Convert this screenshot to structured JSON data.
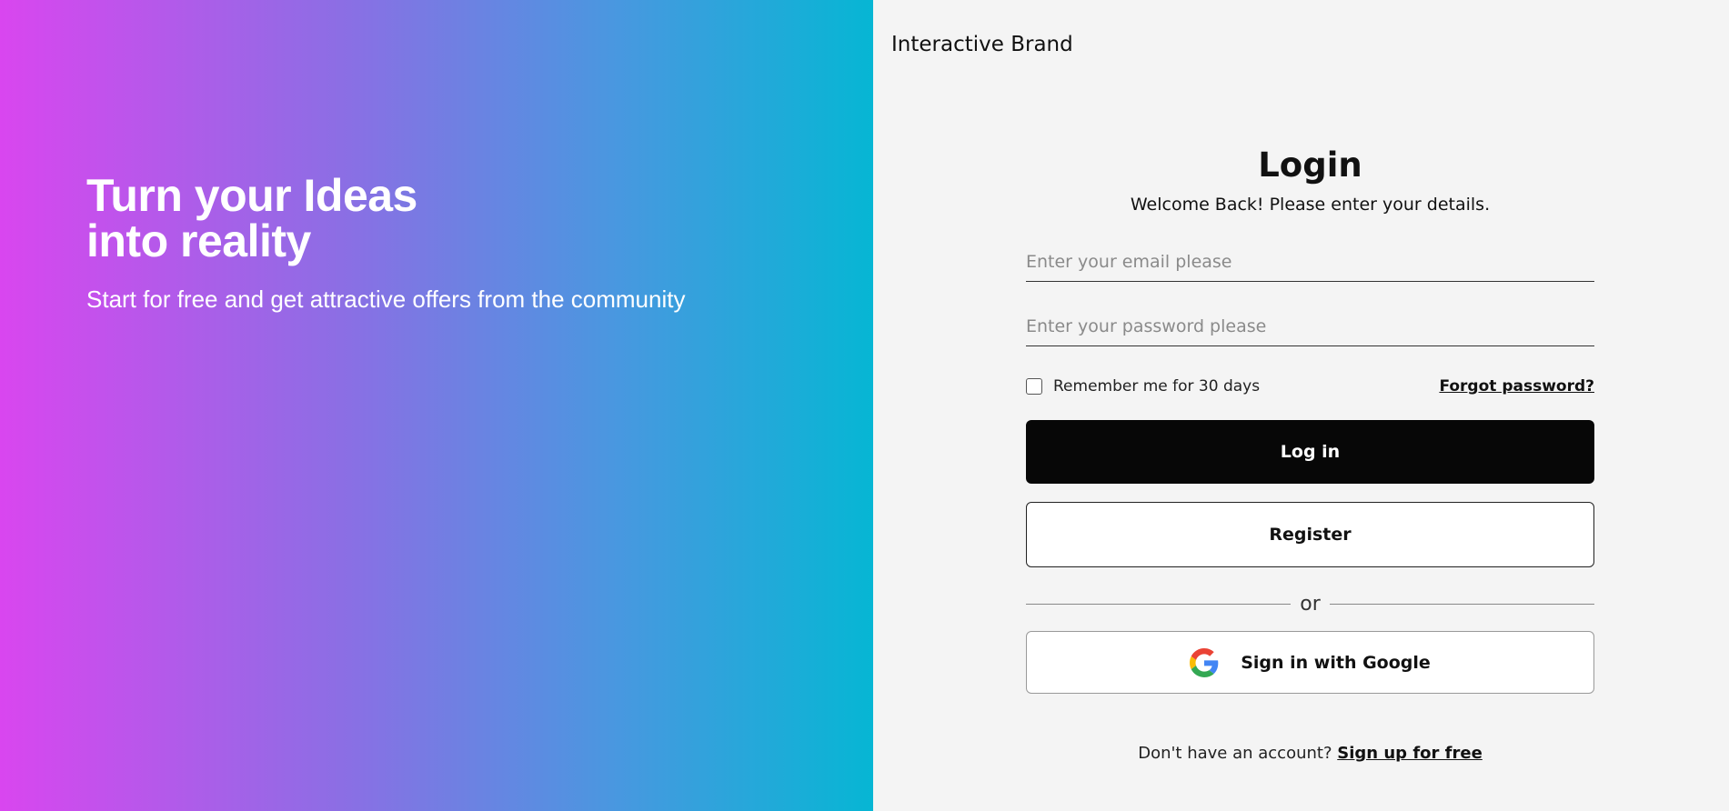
{
  "hero": {
    "title_line1": "Turn your Ideas",
    "title_line2": "into reality",
    "subtitle": "Start for free and get attractive offers from the community",
    "gradient_colors": [
      "#d946ef",
      "#06b6d4"
    ]
  },
  "brand": {
    "name": "Interactive Brand"
  },
  "login": {
    "title": "Login",
    "welcome": "Welcome Back! Please enter your details.",
    "email_placeholder": "Enter your email please",
    "email_value": "",
    "password_placeholder": "Enter your password please",
    "password_value": "",
    "remember_label": "Remember me for 30 days",
    "remember_checked": false,
    "forgot_label": "Forgot password?",
    "login_button": "Log in",
    "register_button": "Register",
    "divider_text": "or",
    "google_button": "Sign in with Google",
    "google_icon": "google-logo-icon",
    "signup_prompt": "Don't have an account?",
    "signup_link": "Sign up for free"
  },
  "colors": {
    "panel_bg": "#f4f4f4",
    "primary_button": "#070707"
  }
}
